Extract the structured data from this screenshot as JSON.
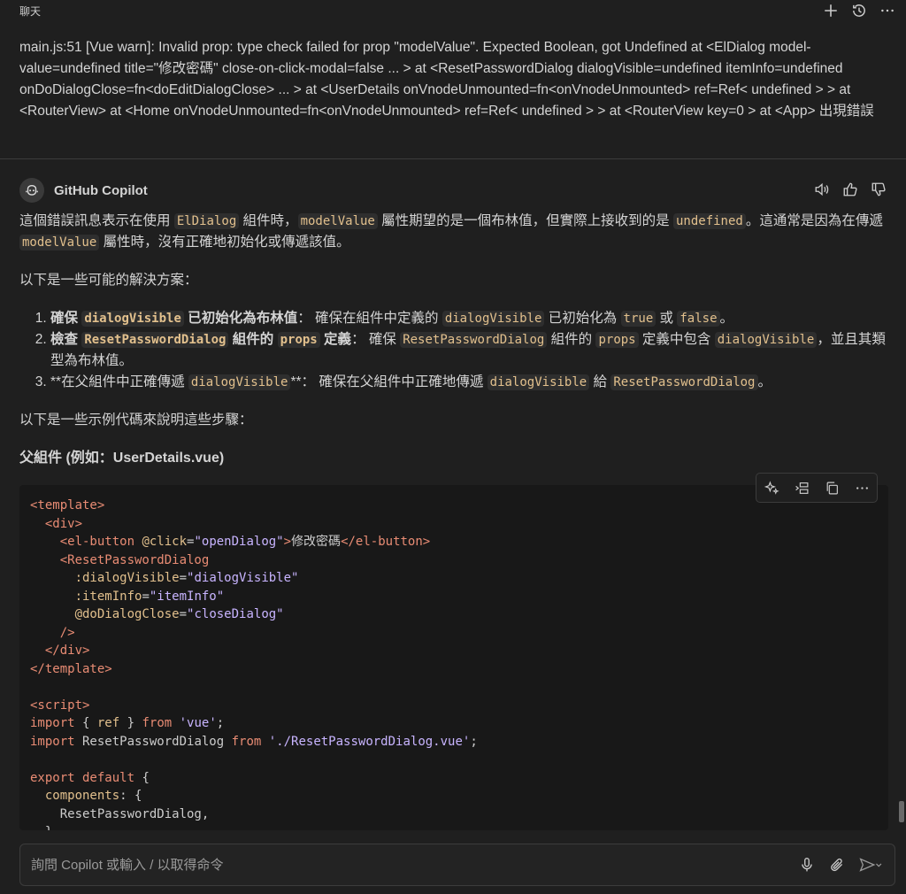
{
  "header": {
    "title": "聊天"
  },
  "user_message": "main.js:51 [Vue warn]: Invalid prop: type check failed for prop \"modelValue\". Expected Boolean, got Undefined at <ElDialog model-value=undefined title=\"修改密碼\" close-on-click-modal=false ... > at <ResetPasswordDialog dialogVisible=undefined itemInfo=undefined onDoDialogClose=fn<doEditDialogClose> ... > at <UserDetails onVnodeUnmounted=fn<onVnodeUnmounted> ref=Ref< undefined > > at <RouterView> at <Home onVnodeUnmounted=fn<onVnodeUnmounted> ref=Ref< undefined > > at <RouterView key=0 > at <App> 出現錯誤",
  "assistant": {
    "name": "GitHub Copilot"
  },
  "answer": {
    "p1": {
      "a": "這個錯誤訊息表示在使用 ",
      "code1": "ElDialog",
      "b": " 組件時，",
      "code2": "modelValue",
      "c": " 屬性期望的是一個布林值，但實際上接收到的是 ",
      "code3": "undefined",
      "d": "。這通常是因為在傳遞 ",
      "code4": "modelValue",
      "e": " 屬性時，沒有正確地初始化或傳遞該值。"
    },
    "p2": "以下是一些可能的解決方案：",
    "step1": {
      "a": "確保 ",
      "code1": "dialogVisible",
      "b": " 已初始化為布林值",
      "c": "： 確保在組件中定義的 ",
      "code2": "dialogVisible",
      "d": " 已初始化為 ",
      "code3": "true",
      "e": " 或 ",
      "code4": "false",
      "f": "。"
    },
    "step2": {
      "a": "檢查 ",
      "code1": "ResetPasswordDialog",
      "b": " 組件的 ",
      "code2": "props",
      "c": " 定義",
      "d": "： 確保 ",
      "code3": "ResetPasswordDialog",
      "e": " 組件的 ",
      "code4": "props",
      "f": " 定義中包含 ",
      "code5": "dialogVisible",
      "g": "，並且其類型為布林值。"
    },
    "step3": {
      "a": "**在父組件中正確傳遞 ",
      "code1": "dialogVisible",
      "b": "**： 確保在父組件中正確地傳遞 ",
      "code2": "dialogVisible",
      "c": " 給 ",
      "code3": "ResetPasswordDialog",
      "d": "。"
    },
    "p3": "以下是一些示例代碼來說明這些步驟：",
    "heading": "父組件 (例如：UserDetails.vue)"
  },
  "code": {
    "lines": [
      {
        "i": "",
        "p": [
          [
            "tag",
            "<template>"
          ]
        ]
      },
      {
        "i": "  ",
        "p": [
          [
            "tag",
            "<div>"
          ]
        ]
      },
      {
        "i": "    ",
        "p": [
          [
            "tag",
            "<el-button"
          ],
          [
            "txt",
            " "
          ],
          [
            "attr",
            "@click"
          ],
          [
            "txt",
            "="
          ],
          [
            "str",
            "\"openDialog\""
          ],
          [
            "tag",
            ">"
          ],
          [
            "txt",
            "修改密碼"
          ],
          [
            "tag",
            "</el-button>"
          ]
        ]
      },
      {
        "i": "    ",
        "p": [
          [
            "tag",
            "<ResetPasswordDialog"
          ]
        ]
      },
      {
        "i": "      ",
        "p": [
          [
            "attr",
            ":dialogVisible"
          ],
          [
            "txt",
            "="
          ],
          [
            "str",
            "\"dialogVisible\""
          ]
        ]
      },
      {
        "i": "      ",
        "p": [
          [
            "attr",
            ":itemInfo"
          ],
          [
            "txt",
            "="
          ],
          [
            "str",
            "\"itemInfo\""
          ]
        ]
      },
      {
        "i": "      ",
        "p": [
          [
            "attr",
            "@doDialogClose"
          ],
          [
            "txt",
            "="
          ],
          [
            "str",
            "\"closeDialog\""
          ]
        ]
      },
      {
        "i": "    ",
        "p": [
          [
            "tag",
            "/>"
          ]
        ]
      },
      {
        "i": "  ",
        "p": [
          [
            "tag",
            "</div>"
          ]
        ]
      },
      {
        "i": "",
        "p": [
          [
            "tag",
            "</template>"
          ]
        ]
      },
      {
        "i": "",
        "p": []
      },
      {
        "i": "",
        "p": [
          [
            "tag",
            "<script>"
          ]
        ]
      },
      {
        "i": "",
        "p": [
          [
            "kw",
            "import"
          ],
          [
            "txt",
            " { "
          ],
          [
            "attr",
            "ref"
          ],
          [
            "txt",
            " } "
          ],
          [
            "kw",
            "from"
          ],
          [
            "txt",
            " "
          ],
          [
            "str",
            "'vue'"
          ],
          [
            "txt",
            ";"
          ]
        ]
      },
      {
        "i": "",
        "p": [
          [
            "kw",
            "import"
          ],
          [
            "txt",
            " ResetPasswordDialog "
          ],
          [
            "kw",
            "from"
          ],
          [
            "txt",
            " "
          ],
          [
            "str",
            "'./ResetPasswordDialog.vue'"
          ],
          [
            "txt",
            ";"
          ]
        ]
      },
      {
        "i": "",
        "p": []
      },
      {
        "i": "",
        "p": [
          [
            "kw",
            "export default"
          ],
          [
            "txt",
            " {"
          ]
        ]
      },
      {
        "i": "  ",
        "p": [
          [
            "attr",
            "components"
          ],
          [
            "txt",
            ": {"
          ]
        ]
      },
      {
        "i": "    ",
        "p": [
          [
            "txt",
            "ResetPasswordDialog,"
          ]
        ]
      },
      {
        "i": "  ",
        "p": [
          [
            "txt",
            "},"
          ]
        ]
      }
    ]
  },
  "input": {
    "placeholder": "詢問 Copilot 或輸入 / 以取得命令"
  }
}
